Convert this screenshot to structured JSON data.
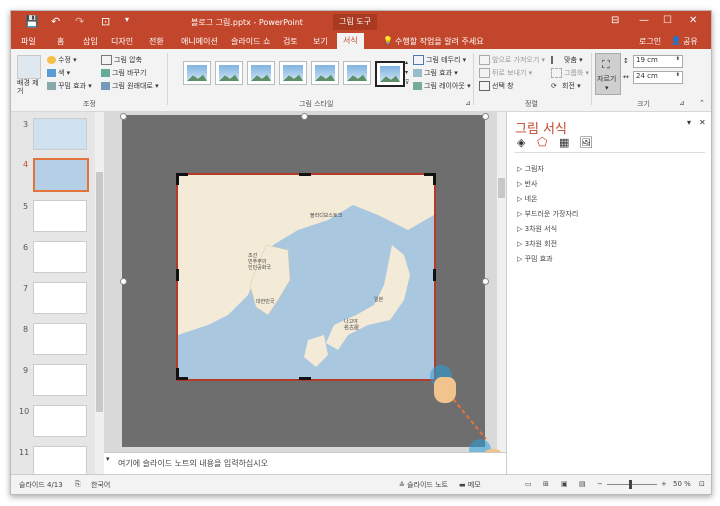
{
  "titlebar": {
    "title": "블로그 그림.pptx - PowerPoint",
    "context_tab": "그림 도구",
    "win_minimize": "—",
    "win_maximize": "☐",
    "win_close": "✕"
  },
  "tabs": [
    "파일",
    "홈",
    "삽입",
    "디자인",
    "전환",
    "애니메이션",
    "슬라이드 쇼",
    "검토",
    "보기",
    "서식"
  ],
  "active_tab": "서식",
  "tell_me": "수행할 작업을 알려 주세요",
  "account": {
    "login": "로그인",
    "share": "공유"
  },
  "ribbon": {
    "adjust": {
      "remove_bg": "배경 제거",
      "corrections": "수정",
      "color": "색",
      "artistic": "꾸밈 효과",
      "compress": "그림 압축",
      "change": "그림 바꾸기",
      "reset": "그림 원래대로",
      "group": "조정"
    },
    "styles": {
      "border": "그림 테두리",
      "effects": "그림 효과",
      "layout": "그림 레이아웃",
      "group": "그림 스타일"
    },
    "arrange": {
      "forward": "앞으로 가져오기",
      "backward": "뒤로 보내기",
      "selection": "선택 창",
      "align": "맞춤",
      "group_btn": "그룹화",
      "rotate": "회전",
      "group": "정렬"
    },
    "size": {
      "crop": "자르기",
      "height": "19 cm",
      "width": "24 cm",
      "group": "크기"
    }
  },
  "slides": [
    "3",
    "4",
    "5",
    "6",
    "7",
    "8",
    "9",
    "10",
    "11"
  ],
  "selected_slide": "4",
  "map_labels": {
    "vladivostok": "블라디보스토크",
    "nk": "조선\n민주주의\n인민공화국",
    "korea": "대한민국",
    "japan": "일본",
    "nagoya": "나고야\n名古屋"
  },
  "notes_placeholder": "여기에 슬라이드 노트의 내용을 입력하십시오",
  "format_pane": {
    "title": "그림 서식",
    "items": [
      "그림자",
      "반사",
      "네온",
      "부드러운 가장자리",
      "3차원 서식",
      "3차원 회전",
      "꾸밈 효과"
    ]
  },
  "status": {
    "slide": "슬라이드 4/13",
    "lang": "한국어",
    "notes": "슬라이드 노트",
    "memo": "메모",
    "zoom": "50 %"
  },
  "colors": {
    "accent": "#c2462b",
    "crop_border": "#b43a2a",
    "map_water": "#aac7e0",
    "map_land": "#f3ead7"
  }
}
